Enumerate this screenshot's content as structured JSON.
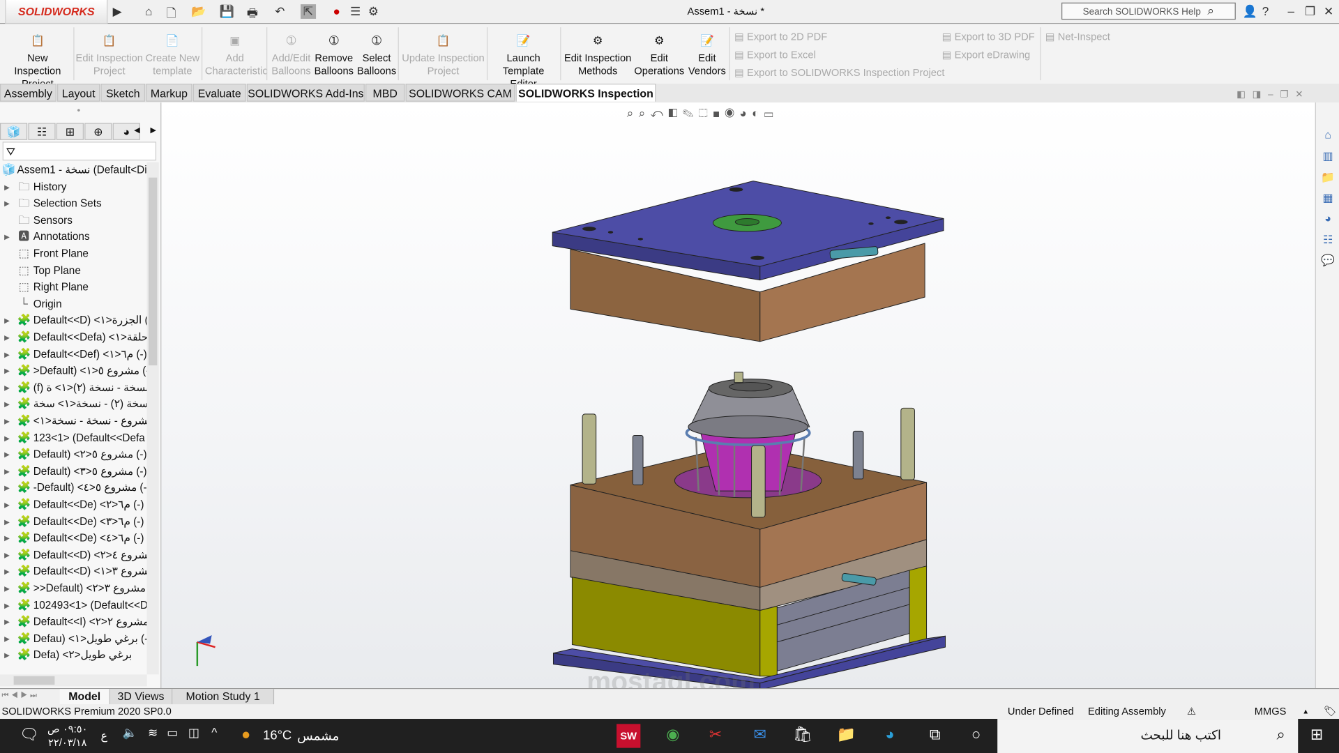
{
  "app": {
    "brand": "SOLIDWORKS",
    "title": "Assem1 - نسخة *",
    "search_placeholder": "Search SOLIDWORKS Help"
  },
  "quick_access": [
    "home-icon",
    "new-file-icon",
    "open-icon",
    "save-icon",
    "print-icon",
    "undo-icon",
    "select-icon",
    "rebuild-icon",
    "file-properties-icon",
    "options-icon"
  ],
  "ribbon": {
    "buttons": [
      {
        "label1": "New Inspection",
        "label2": "Project",
        "enabled": true
      },
      {
        "label1": "Edit Inspection",
        "label2": "Project",
        "enabled": false
      },
      {
        "label1": "Create New",
        "label2": "template",
        "enabled": false
      },
      {
        "label1": "Add",
        "label2": "Characteristic",
        "enabled": false
      },
      {
        "label1": "Add/Edit",
        "label2": "Balloons",
        "enabled": false
      },
      {
        "label1": "Remove",
        "label2": "Balloons",
        "enabled": true
      },
      {
        "label1": "Select",
        "label2": "Balloons",
        "enabled": true
      },
      {
        "label1": "Update Inspection",
        "label2": "Project",
        "enabled": false
      },
      {
        "label1": "Launch",
        "label2": "Template Editor",
        "enabled": true
      },
      {
        "label1": "Edit Inspection",
        "label2": "Methods",
        "enabled": true
      },
      {
        "label1": "Edit",
        "label2": "Operations",
        "enabled": true
      },
      {
        "label1": "Edit",
        "label2": "Vendors",
        "enabled": true
      }
    ],
    "exports": [
      "Export to 2D PDF",
      "Export to Excel",
      "Export to SOLIDWORKS Inspection Project",
      "Export to 3D PDF",
      "Export eDrawing",
      "Net-Inspect"
    ]
  },
  "tabs": [
    "Assembly",
    "Layout",
    "Sketch",
    "Markup",
    "Evaluate",
    "SOLIDWORKS Add-Ins",
    "MBD",
    "SOLIDWORKS CAM",
    "SOLIDWORKS Inspection"
  ],
  "active_tab": "SOLIDWORKS Inspection",
  "tree": {
    "root": "Assem1 - نسخة  (Default<Di",
    "items": [
      {
        "label": "History",
        "icon": "history-folder-icon",
        "expand": true
      },
      {
        "label": "Selection Sets",
        "icon": "selection-sets-icon",
        "expand": true
      },
      {
        "label": "Sensors",
        "icon": "sensors-icon",
        "expand": false
      },
      {
        "label": "Annotations",
        "icon": "annotations-icon",
        "expand": true
      },
      {
        "label": "Front Plane",
        "icon": "plane-icon",
        "expand": false
      },
      {
        "label": "Top Plane",
        "icon": "plane-icon",
        "expand": false
      },
      {
        "label": "Right Plane",
        "icon": "plane-icon",
        "expand": false
      },
      {
        "label": "Origin",
        "icon": "origin-icon",
        "expand": false
      },
      {
        "label": "(-) الجزرة<١> (Default<<D",
        "icon": "part-icon",
        "expand": true
      },
      {
        "label": "حلقة<١> (Default<<Defa",
        "icon": "part-icon",
        "expand": true
      },
      {
        "label": "(-) م٦<١> (Default<<Def",
        "icon": "part-icon",
        "expand": true
      },
      {
        "label": "(-) مشروع ٥<١> (Default<",
        "icon": "part-icon",
        "expand": true
      },
      {
        "label": "(f) نسخة - نسخة (٢)<١> ة",
        "icon": "part-icon",
        "expand": true
      },
      {
        "label": "نسخة - نسخة (٢) - نسخة<١> سخة",
        "icon": "part-icon",
        "expand": true
      },
      {
        "label": "(-) مشروع - نسخة - نسخة<١>",
        "icon": "part-icon",
        "expand": true
      },
      {
        "label": "123<1> (Default<<Defa",
        "icon": "part-icon",
        "expand": true
      },
      {
        "label": "(-) مشروع ٥<٢> (Default",
        "icon": "part-icon",
        "expand": true
      },
      {
        "label": "(-) مشروع ٥<٣> (Default",
        "icon": "part-icon",
        "expand": true
      },
      {
        "label": "(-) مشروع ٥<٤> (Default-",
        "icon": "part-icon",
        "expand": true
      },
      {
        "label": "(-) م٦<٢> (Default<<De",
        "icon": "part-icon",
        "expand": true
      },
      {
        "label": "(-) م٦<٣> (Default<<De",
        "icon": "part-icon",
        "expand": true
      },
      {
        "label": "(-) م٦<٤> (Default<<De",
        "icon": "part-icon",
        "expand": true
      },
      {
        "label": "مشروع ٤<٢> (Default<<D",
        "icon": "part-icon",
        "expand": true
      },
      {
        "label": "مشروع ٣<١> (Default<<D",
        "icon": "part-icon",
        "expand": true
      },
      {
        "label": "مشروع ٣<٢> (Default<<",
        "icon": "part-icon",
        "expand": true
      },
      {
        "label": "102493<1> (Default<<D",
        "icon": "part-icon",
        "expand": true
      },
      {
        "label": "مشروع ٢<٢> (Default<<I",
        "icon": "part-icon",
        "expand": true
      },
      {
        "label": "(-) برغي طويل<١> (Defau",
        "icon": "part-icon",
        "expand": true
      },
      {
        "label": "برغي طويل<٢> (Defa",
        "icon": "part-icon",
        "expand": true
      }
    ]
  },
  "bottom_tabs": [
    "Model",
    "3D Views",
    "Motion Study 1"
  ],
  "status": {
    "left": "SOLIDWORKS Premium 2020 SP0.0",
    "state": "Under Defined",
    "mode": "Editing Assembly",
    "units": "MMGS"
  },
  "taskbar": {
    "time": "٠٩:٥٠ ص",
    "date": "٢٢/٠٣/١٨",
    "lang": "ع",
    "weather": "16°C",
    "weather_text": "مشمس",
    "search": "اكتب هنا للبحث"
  },
  "watermark": "mostaql.com",
  "colors": {
    "plate": "#4b4b9c",
    "block": "#9a6a44",
    "yellow": "#a9a800",
    "accent": "#d52b1e"
  }
}
